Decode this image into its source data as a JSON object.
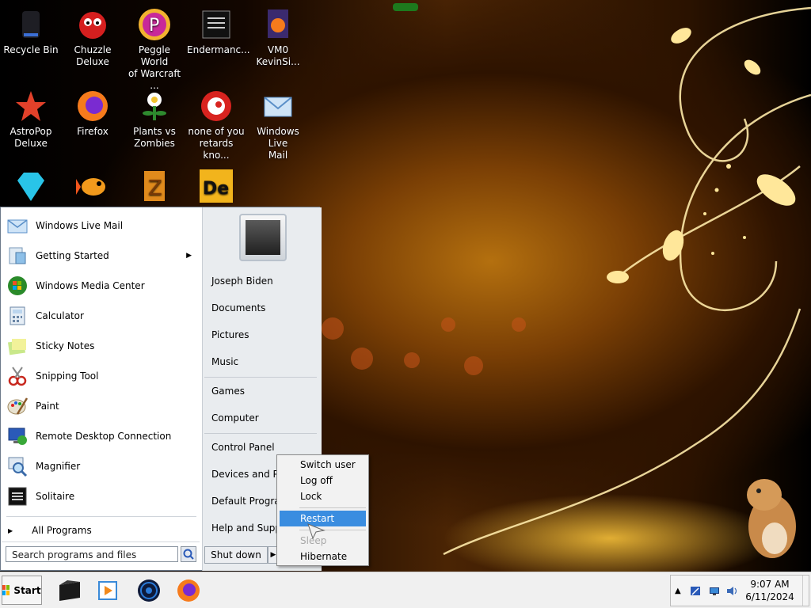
{
  "desktop": {
    "icons": [
      {
        "label": "Recycle Bin",
        "icon": "recycle-bin-icon"
      },
      {
        "label": "Chuzzle\nDeluxe",
        "icon": "chuzzle-icon"
      },
      {
        "label": "Peggle World\nof Warcraft ...",
        "icon": "peggle-icon"
      },
      {
        "label": "Endermanc...",
        "icon": "endermanch-icon"
      },
      {
        "label": "VM0\nKevinSi...",
        "icon": "firefox-file-icon"
      },
      {
        "label": "AstroPop\nDeluxe",
        "icon": "astropop-icon"
      },
      {
        "label": "Firefox",
        "icon": "firefox-icon"
      },
      {
        "label": "Plants vs\nZombies",
        "icon": "plants-vs-zombies-icon"
      },
      {
        "label": "none of you\nretards kno...",
        "icon": "none-of-you-icon"
      },
      {
        "label": "Windows Live\nMail",
        "icon": "windows-live-mail-icon"
      },
      {
        "label": "",
        "icon": "diamond-icon"
      },
      {
        "label": "",
        "icon": "goldfish-icon"
      },
      {
        "label": "",
        "icon": "zuma-icon"
      },
      {
        "label": "",
        "icon": "de-icon"
      }
    ]
  },
  "start_menu": {
    "programs": [
      {
        "label": "Windows Live Mail",
        "icon": "windows-live-mail-icon",
        "submenu": false
      },
      {
        "label": "Getting Started",
        "icon": "getting-started-icon",
        "submenu": true
      },
      {
        "label": "Windows Media Center",
        "icon": "windows-media-center-icon",
        "submenu": false
      },
      {
        "label": "Calculator",
        "icon": "calculator-icon",
        "submenu": false
      },
      {
        "label": "Sticky Notes",
        "icon": "sticky-notes-icon",
        "submenu": false
      },
      {
        "label": "Snipping Tool",
        "icon": "snipping-tool-icon",
        "submenu": false
      },
      {
        "label": "Paint",
        "icon": "paint-icon",
        "submenu": false
      },
      {
        "label": "Remote Desktop Connection",
        "icon": "remote-desktop-icon",
        "submenu": false
      },
      {
        "label": "Magnifier",
        "icon": "magnifier-icon",
        "submenu": false
      },
      {
        "label": "Solitaire",
        "icon": "solitaire-icon",
        "submenu": false
      }
    ],
    "all_programs": "All Programs",
    "search_placeholder": "Search programs and files",
    "right_items": [
      {
        "label": "Joseph Biden"
      },
      {
        "label": "Documents"
      },
      {
        "label": "Pictures"
      },
      {
        "label": "Music"
      },
      {
        "label": "Games"
      },
      {
        "label": "Computer"
      },
      {
        "label": "Control Panel"
      },
      {
        "label": "Devices and Prin"
      },
      {
        "label": "Default Program"
      },
      {
        "label": "Help and Suppo"
      }
    ],
    "shutdown_label": "Shut down"
  },
  "shutdown_menu": {
    "items": [
      {
        "label": "Switch user",
        "state": "normal"
      },
      {
        "label": "Log off",
        "state": "normal"
      },
      {
        "label": "Lock",
        "state": "normal"
      },
      {
        "label": "Restart",
        "state": "highlighted"
      },
      {
        "label": "Sleep",
        "state": "disabled"
      },
      {
        "label": "Hibernate",
        "state": "normal"
      }
    ]
  },
  "taskbar": {
    "start_label": "Start",
    "pinned": [
      "terminal-icon",
      "media-player-icon",
      "globe-icon",
      "firefox-icon"
    ],
    "tray": {
      "icons": [
        "show-hidden-icons-icon",
        "action-center-icon",
        "network-icon",
        "volume-icon"
      ],
      "time": "9:07 AM",
      "date": "6/11/2024"
    }
  },
  "colors": {
    "highlight": "#3a8de0",
    "taskbar": "#f0f0f0",
    "menu_right": "#e9ecef"
  }
}
